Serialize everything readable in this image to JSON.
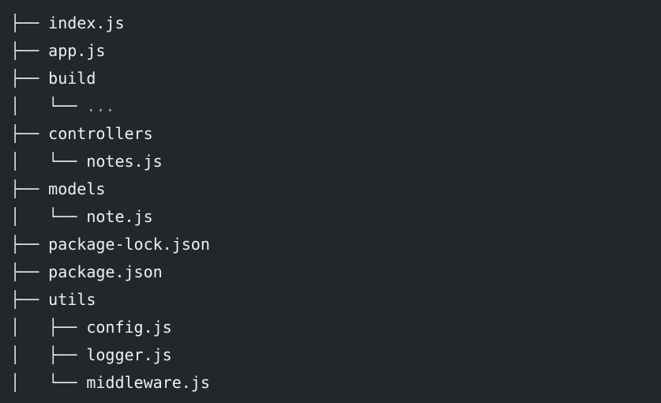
{
  "tree": {
    "rows": [
      {
        "prefix": "├── ",
        "name": "index.js"
      },
      {
        "prefix": "├── ",
        "name": "app.js"
      },
      {
        "prefix": "├── ",
        "name": "build"
      },
      {
        "prefix": "│   └── ",
        "name": "..."
      },
      {
        "prefix": "├── ",
        "name": "controllers"
      },
      {
        "prefix": "│   └── ",
        "name": "notes.js"
      },
      {
        "prefix": "├── ",
        "name": "models"
      },
      {
        "prefix": "│   └── ",
        "name": "note.js"
      },
      {
        "prefix": "├── ",
        "name": "package-lock.json"
      },
      {
        "prefix": "├── ",
        "name": "package.json"
      },
      {
        "prefix": "├── ",
        "name": "utils"
      },
      {
        "prefix": "│   ├── ",
        "name": "config.js"
      },
      {
        "prefix": "│   ├── ",
        "name": "logger.js"
      },
      {
        "prefix": "│   └── ",
        "name": "middleware.js"
      }
    ]
  },
  "colors": {
    "background": "#22272b",
    "text": "#eef0f2",
    "muted": "#9aa3ab"
  }
}
